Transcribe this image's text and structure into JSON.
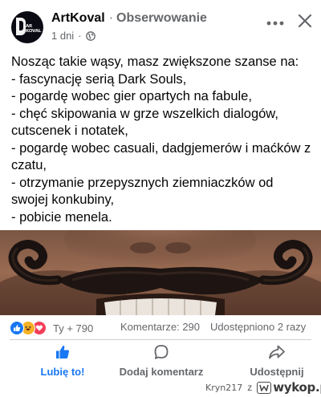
{
  "post": {
    "author": "ArtKoval",
    "separator": "·",
    "follow_label": "Obserwowanie",
    "time": "1 dni",
    "meta_sep": "·",
    "avatar_text": "AR\nKOVAL",
    "lines": [
      "Nosząc takie wąsy, masz zwiększone szanse na:",
      "- fascynację serią Dark Souls,",
      "- pogardę wobec gier opartych na fabule,",
      "- chęć skipowania w grze wszelkich dialogów, cutscenek i notatek,",
      "- pogardę wobec casuali, dadgjemerów i maćków z czatu,",
      "- otrzymanie przepysznych ziemniaczków od swojej konkubiny,",
      "- pobicie menela."
    ]
  },
  "engagement": {
    "reaction_count": "Ty + 790",
    "comments": "Komentarze: 290",
    "shares": "Udostępniono 2 razy"
  },
  "actions": {
    "like": "Lubię to!",
    "comment": "Dodaj komentarz",
    "share": "Udostępnij"
  },
  "footer": {
    "user": "Kryn217",
    "z": "z",
    "site": "wykop.pl"
  },
  "icons": {
    "more": "more-dots-icon",
    "close": "close-icon",
    "globe": "globe-icon",
    "like": "thumbs-up-icon",
    "comment": "comment-bubble-icon",
    "share": "share-arrow-icon"
  },
  "colors": {
    "accent": "#1877f2",
    "secondary_text": "#65676b",
    "love": "#f33e58",
    "haha": "#f7b125"
  }
}
